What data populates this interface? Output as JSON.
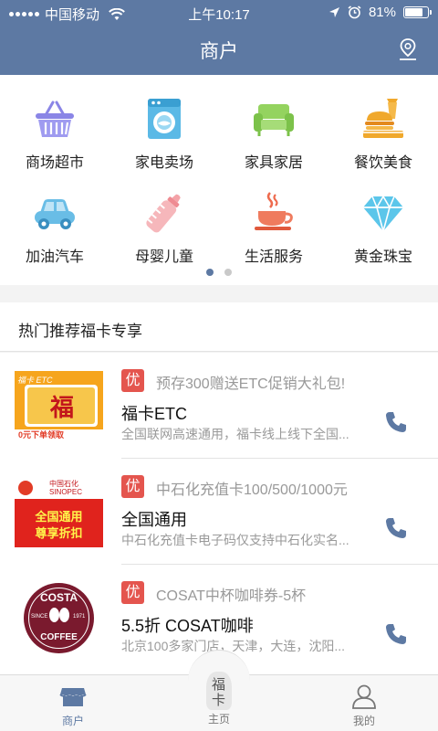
{
  "status_bar": {
    "carrier": "中国移动",
    "time": "上午10:17",
    "battery": "81%",
    "battery_level": 0.81
  },
  "header": {
    "title": "商户",
    "map_icon": "location-pin-icon"
  },
  "categories": [
    {
      "label": "商场超市",
      "icon": "basket-icon"
    },
    {
      "label": "家电卖场",
      "icon": "washing-machine-icon"
    },
    {
      "label": "家具家居",
      "icon": "sofa-icon"
    },
    {
      "label": "餐饮美食",
      "icon": "fast-food-icon"
    },
    {
      "label": "加油汽车",
      "icon": "car-icon"
    },
    {
      "label": "母婴儿童",
      "icon": "baby-bottle-icon"
    },
    {
      "label": "生活服务",
      "icon": "coffee-cup-icon"
    },
    {
      "label": "黄金珠宝",
      "icon": "diamond-icon"
    }
  ],
  "pager": {
    "pages": 2,
    "current": 1
  },
  "section": {
    "title": "热门推荐福卡专享"
  },
  "items": [
    {
      "badge": "优",
      "promo": "预存300赠送ETC促销大礼包!",
      "name": "福卡ETC",
      "desc": "全国联网高速通用，福卡线上线下全国...",
      "thumb": {
        "card_title": "福卡 ETC",
        "card_char": "福",
        "card_footer": "0元下单领取"
      }
    },
    {
      "badge": "优",
      "promo": "中石化充值卡100/500/1000元",
      "name": "全国通用",
      "desc": "中石化充值卡电子码仅支持中石化实名...",
      "thumb": {
        "brand_cn": "中国石化",
        "brand_en": "SINOPEC",
        "line1": "全国通用",
        "line2": "尊享折扣"
      }
    },
    {
      "badge": "优",
      "promo": "COSAT中杯咖啡券-5杯",
      "name": "5.5折 COSAT咖啡",
      "desc": "北京100多家门店，天津，大连，沈阳...",
      "thumb": {
        "top": "COSTA",
        "bottom": "COFFEE",
        "since": "SINCE",
        "year": "1971"
      }
    }
  ],
  "tabbar": {
    "tabs": [
      {
        "label": "商户",
        "icon": "shop-icon",
        "active": true
      },
      {
        "label": "主页",
        "icon": "fuka-home-icon",
        "active": false,
        "logo_text_top": "福",
        "logo_text_bottom": "卡"
      },
      {
        "label": "我的",
        "icon": "person-icon",
        "active": false
      }
    ]
  },
  "colors": {
    "primary": "#5d79a3",
    "badge": "#e4554e",
    "dot_inactive": "#c9c9c9"
  }
}
